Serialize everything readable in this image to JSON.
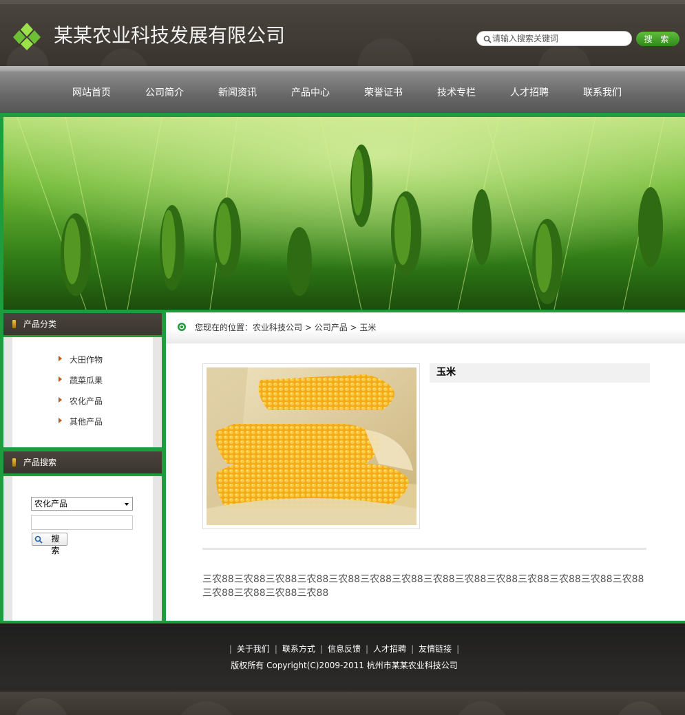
{
  "header": {
    "site_title": "某某农业科技发展有限公司",
    "search_placeholder": "请输入搜索关键词",
    "search_button": "搜 索"
  },
  "nav": {
    "items": [
      "网站首页",
      "公司简介",
      "新闻资讯",
      "产品中心",
      "荣誉证书",
      "技术专栏",
      "人才招聘",
      "联系我们"
    ]
  },
  "sidebar": {
    "category_title": "产品分类",
    "categories": [
      "大田作物",
      "蔬菜瓜果",
      "农化产品",
      "其他产品"
    ],
    "search_title": "产品搜索",
    "search_select_value": "农化产品",
    "search_button": "搜 索"
  },
  "main": {
    "breadcrumb": {
      "prefix": "您现在的位置：",
      "home": "农业科技公司",
      "sep1": " > ",
      "section": "公司产品",
      "sep2": " > ",
      "current": "玉米"
    },
    "product_title": "玉米",
    "description": "三农88三农88三农88三农88三农88三农88三农88三农88三农88三农88三农88三农88三农88三农88三农88三农88三农88三农88"
  },
  "footer": {
    "links": [
      "关于我们",
      "联系方式",
      "信息反馈",
      "人才招聘",
      "友情链接"
    ],
    "separator": "|",
    "copyright": "版权所有  Copyright(C)2009-2011 杭州市某某农业科技公司"
  },
  "colors": {
    "accent_green": "#1e9c3e",
    "header_dark": "#3a342f",
    "nav_gray": "#6a6a6a",
    "bullet_orange": "#c9531b"
  }
}
